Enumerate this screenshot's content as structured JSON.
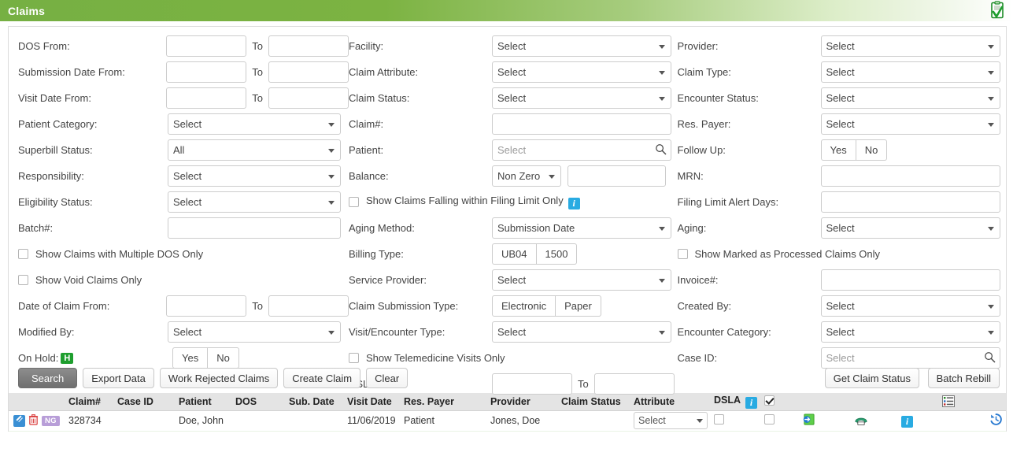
{
  "header": {
    "title": "Claims",
    "icon": "clipboard-check-icon"
  },
  "colors": {
    "brand_green": "#7cb342",
    "primary_btn": "#6f6f6f",
    "info_blue": "#29abe2",
    "hold_green": "#1e9e2e",
    "ng_purple": "#b89ed8"
  },
  "common": {
    "select_placeholder": "Select",
    "to_label": "To",
    "yes": "Yes",
    "no": "No"
  },
  "column1": {
    "rows": [
      {
        "type": "daterange",
        "label": "DOS From:",
        "from": "",
        "to": ""
      },
      {
        "type": "daterange",
        "label": "Submission Date From:",
        "from": "",
        "to": ""
      },
      {
        "type": "daterange",
        "label": "Visit Date From:",
        "from": "",
        "to": ""
      },
      {
        "type": "select",
        "label": "Patient Category:",
        "value": "Select"
      },
      {
        "type": "select",
        "label": "Superbill Status:",
        "value": "All"
      },
      {
        "type": "select",
        "label": "Responsibility:",
        "value": "Select"
      },
      {
        "type": "select",
        "label": "Eligibility Status:",
        "value": "Select"
      },
      {
        "type": "text",
        "label": "Batch#:",
        "value": ""
      },
      {
        "type": "checkbox",
        "label": "Show Claims with Multiple DOS Only",
        "checked": false
      },
      {
        "type": "checkbox",
        "label": "Show Void Claims Only",
        "checked": false
      },
      {
        "type": "daterange",
        "label": "Date of Claim From:",
        "from": "",
        "to": ""
      },
      {
        "type": "select",
        "label": "Modified By:",
        "value": "Select"
      },
      {
        "type": "toggle",
        "label": "On Hold:",
        "badge": "H",
        "options": [
          "Yes",
          "No"
        ]
      }
    ]
  },
  "column2": {
    "rows": [
      {
        "type": "select",
        "label": "Facility:",
        "value": "Select"
      },
      {
        "type": "select",
        "label": "Claim Attribute:",
        "value": "Select"
      },
      {
        "type": "select",
        "label": "Claim Status:",
        "value": "Select"
      },
      {
        "type": "text",
        "label": "Claim#:",
        "value": ""
      },
      {
        "type": "search",
        "label": "Patient:",
        "value": "",
        "placeholder": "Select"
      },
      {
        "type": "balance",
        "label": "Balance:",
        "value": "Non Zero",
        "amount": ""
      },
      {
        "type": "checkbox",
        "label": "Show Claims Falling within Filing Limit Only",
        "checked": false,
        "info": true
      },
      {
        "type": "select",
        "label": "Aging Method:",
        "value": "Submission Date"
      },
      {
        "type": "toggle",
        "label": "Billing Type:",
        "options": [
          "UB04",
          "1500"
        ]
      },
      {
        "type": "select",
        "label": "Service Provider:",
        "value": "Select"
      },
      {
        "type": "toggle",
        "label": "Claim Submission Type:",
        "options": [
          "Electronic",
          "Paper"
        ]
      },
      {
        "type": "select",
        "label": "Visit/Encounter Type:",
        "value": "Select"
      },
      {
        "type": "checkbox",
        "label": "Show Telemedicine Visits Only",
        "checked": false
      },
      {
        "type": "daterange",
        "label": "DSLA From:",
        "from": "",
        "to": ""
      }
    ]
  },
  "column3": {
    "rows": [
      {
        "type": "select",
        "label": "Provider:",
        "value": "Select"
      },
      {
        "type": "select",
        "label": "Claim Type:",
        "value": "Select"
      },
      {
        "type": "select",
        "label": "Encounter Status:",
        "value": "Select"
      },
      {
        "type": "select",
        "label": "Res. Payer:",
        "value": "Select"
      },
      {
        "type": "toggle",
        "label": "Follow Up:",
        "options": [
          "Yes",
          "No"
        ]
      },
      {
        "type": "text",
        "label": "MRN:",
        "value": ""
      },
      {
        "type": "text",
        "label": "Filing Limit Alert Days:",
        "value": "",
        "disabled": true
      },
      {
        "type": "select",
        "label": "Aging:",
        "value": "Select"
      },
      {
        "type": "checkbox",
        "label": "Show Marked as Processed Claims Only",
        "checked": false
      },
      {
        "type": "text",
        "label": "Invoice#:",
        "value": ""
      },
      {
        "type": "select",
        "label": "Created By:",
        "value": "Select"
      },
      {
        "type": "select",
        "label": "Encounter Category:",
        "value": "Select"
      },
      {
        "type": "search",
        "label": "Case ID:",
        "value": "",
        "placeholder": "Select"
      }
    ]
  },
  "buttons": {
    "left": [
      "Search",
      "Export Data",
      "Work Rejected Claims",
      "Create Claim",
      "Clear"
    ],
    "right": [
      "Get Claim Status",
      "Batch Rebill"
    ]
  },
  "table": {
    "columns": [
      "",
      "Claim#",
      "Case ID",
      "Patient",
      "DOS",
      "Sub. Date",
      "Visit Date",
      "Res. Payer",
      "Provider",
      "Claim Status",
      "Attribute",
      "DSLA",
      "",
      "",
      "",
      "",
      ""
    ],
    "header_dsla_info": true,
    "header_select_all_checked": true,
    "header_grid_icon": "list-settings-icon",
    "rows": [
      {
        "actions": [
          "edit-icon",
          "delete-icon",
          "NG"
        ],
        "claim_number": "328734",
        "case_id": "",
        "patient": "Doe, John",
        "dos": "",
        "sub_date": "",
        "visit_date": "11/06/2019",
        "res_payer": "Patient",
        "provider": "Jones, Doe",
        "claim_status": "",
        "attribute": "Select",
        "dsla_checked": false,
        "select_checked": false,
        "row_icons": [
          "rebill-icon",
          "phone-icon",
          "info-icon",
          "history-icon"
        ]
      }
    ]
  }
}
